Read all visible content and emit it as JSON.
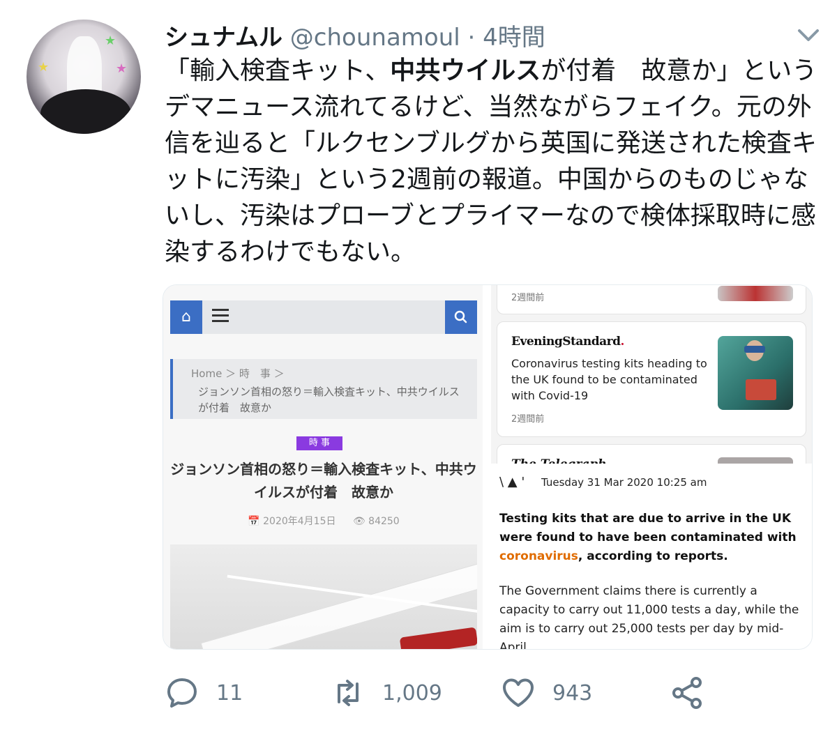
{
  "tweet": {
    "display_name": "シュナムル",
    "handle": "@chounamoul",
    "separator": "·",
    "time_ago": "4時間",
    "text_part1": "「輸入検査キット、",
    "text_bold": "中共ウイルス",
    "text_part2": "が付着　故意か」というデマニュース流れてるけど、当然ながらフェイク。元の外信を辿ると「ルクセンブルグから英国に発送された検査キットに汚染」という2週前の報道。中国からのものじゃないし、汚染はプローブとプライマーなので検体採取時に感染するわけでもない。"
  },
  "left_screenshot": {
    "breadcrumb_line1": "Home ＞ 時　事 ＞",
    "breadcrumb_line2": "ジョンソン首相の怒り＝輸入検査キット、中共ウイルスが付着　故意か",
    "category_tag": "時 事",
    "article_title": "ジョンソン首相の怒り＝輸入検査キット、中共ウイルスが付着　故意か",
    "date": "📅 2020年4月15日",
    "views": "👁 84250"
  },
  "right_top_screenshot": {
    "card_top_ago": "2週間前",
    "source_logo": "EveningStandard",
    "source_logo_dot": ".",
    "headline": "Coronavirus testing kits heading to the UK found to be contaminated with Covid-19",
    "ago": "2週間前",
    "next_source_logo": "The Telegraph"
  },
  "right_bottom_screenshot": {
    "logo_glyphs": "\\ ▲ '",
    "timestamp": "Tuesday 31 Mar 2020 10:25 am",
    "lead_before": "Testing kits that are due to arrive in the UK were found to have been contaminated with ",
    "lead_highlight": "coronavirus",
    "lead_after": ", according to reports.",
    "body": "The Government claims there is currently a capacity to carry out 11,000 tests a day, while the aim is to carry out 25,000 tests per day by mid-April."
  },
  "actions": {
    "reply_count": "11",
    "retweet_count": "1,009",
    "like_count": "943"
  },
  "icons": [
    "chevron-down-icon",
    "home-icon",
    "menu-icon",
    "search-icon",
    "reply-icon",
    "retweet-icon",
    "like-icon",
    "share-icon"
  ],
  "colors": {
    "nav_blue": "#3b6ec4",
    "tag_purple": "#8a3ae0",
    "secondary_text": "#657786",
    "highlight_orange": "#e06c00"
  }
}
